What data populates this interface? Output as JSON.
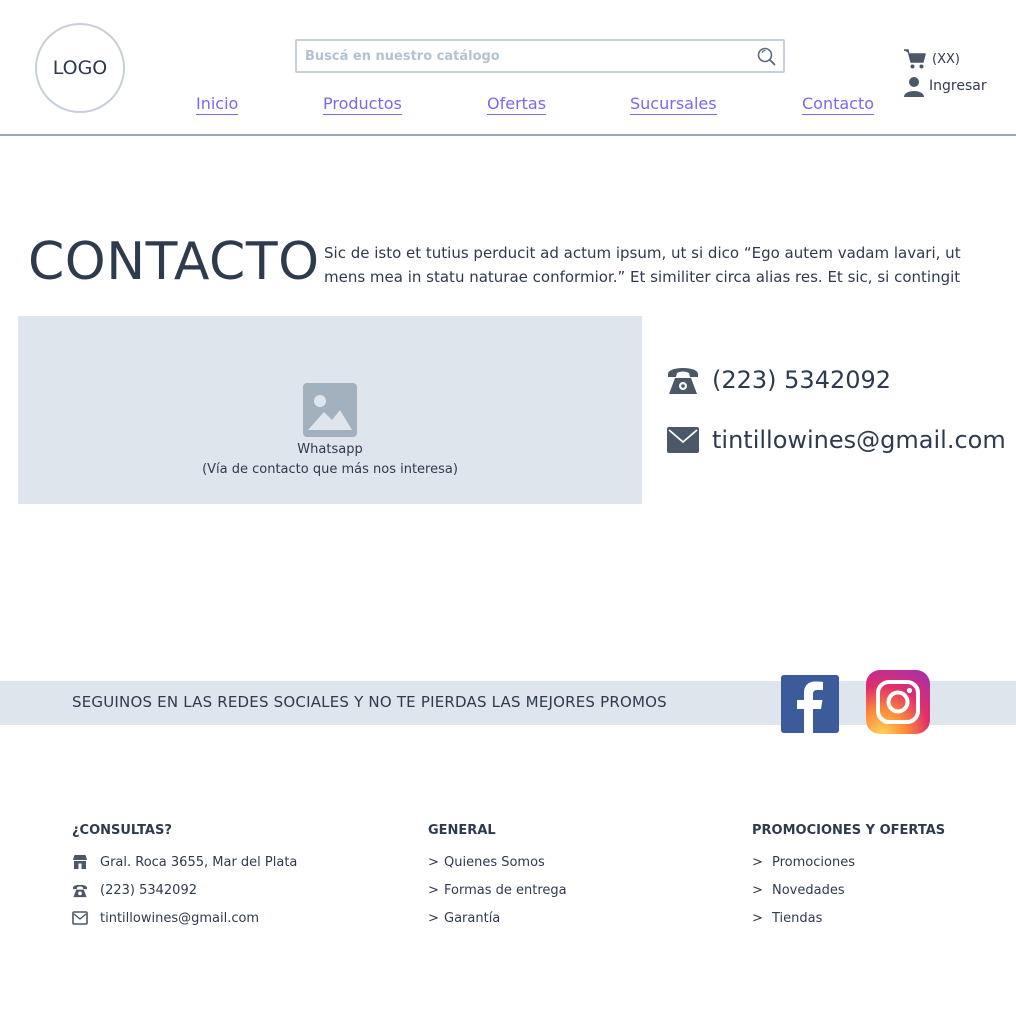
{
  "header": {
    "logo": "LOGO",
    "search": {
      "placeholder": "Buscá en nuestro catálogo",
      "value": ""
    },
    "nav": [
      {
        "label": "Inicio"
      },
      {
        "label": "Productos"
      },
      {
        "label": "Ofertas"
      },
      {
        "label": "Sucursales"
      },
      {
        "label": "Contacto"
      }
    ],
    "cart_count": "(XX)",
    "login_label": "Ingresar",
    "icons": {
      "search": "search-icon",
      "cart": "cart-icon",
      "user": "user-icon"
    }
  },
  "contact": {
    "title": "CONTACTO",
    "text": "Sic de isto et tutius perducit ad actum ipsum, ut si dico “Ego autem vadam lavari, ut mens mea in statu naturae conformior.” Et similiter circa alias res. Et sic, si contingit",
    "media": {
      "label_1": "Whatsapp",
      "label_2": "(Vía de contacto que más nos interesa)"
    },
    "phone": "(223) 5342092",
    "email": "tintillowines@gmail.com"
  },
  "social": {
    "text": "SEGUINOS EN LAS REDES SOCIALES Y NO TE PIERDAS LAS MEJORES PROMOS",
    "icons": [
      "facebook-icon",
      "instagram-icon"
    ]
  },
  "footer": {
    "consultas": {
      "heading": "¿CONSULTAS?",
      "address": "Gral. Roca 3655, Mar del Plata",
      "phone": "(223) 5342092",
      "email": "tintillowines@gmail.com"
    },
    "general": {
      "heading": "GENERAL",
      "items": [
        "Quienes Somos",
        "Formas de entrega",
        "Garantía"
      ]
    },
    "promos": {
      "heading": "PROMOCIONES Y OFERTAS",
      "items": [
        "Promociones",
        "Novedades",
        "Tiendas"
      ]
    }
  },
  "colors": {
    "link": "#7b68ee",
    "text": "#2e3b4e",
    "panel": "#dfe5ed",
    "facebook": "#3b5b9a"
  }
}
